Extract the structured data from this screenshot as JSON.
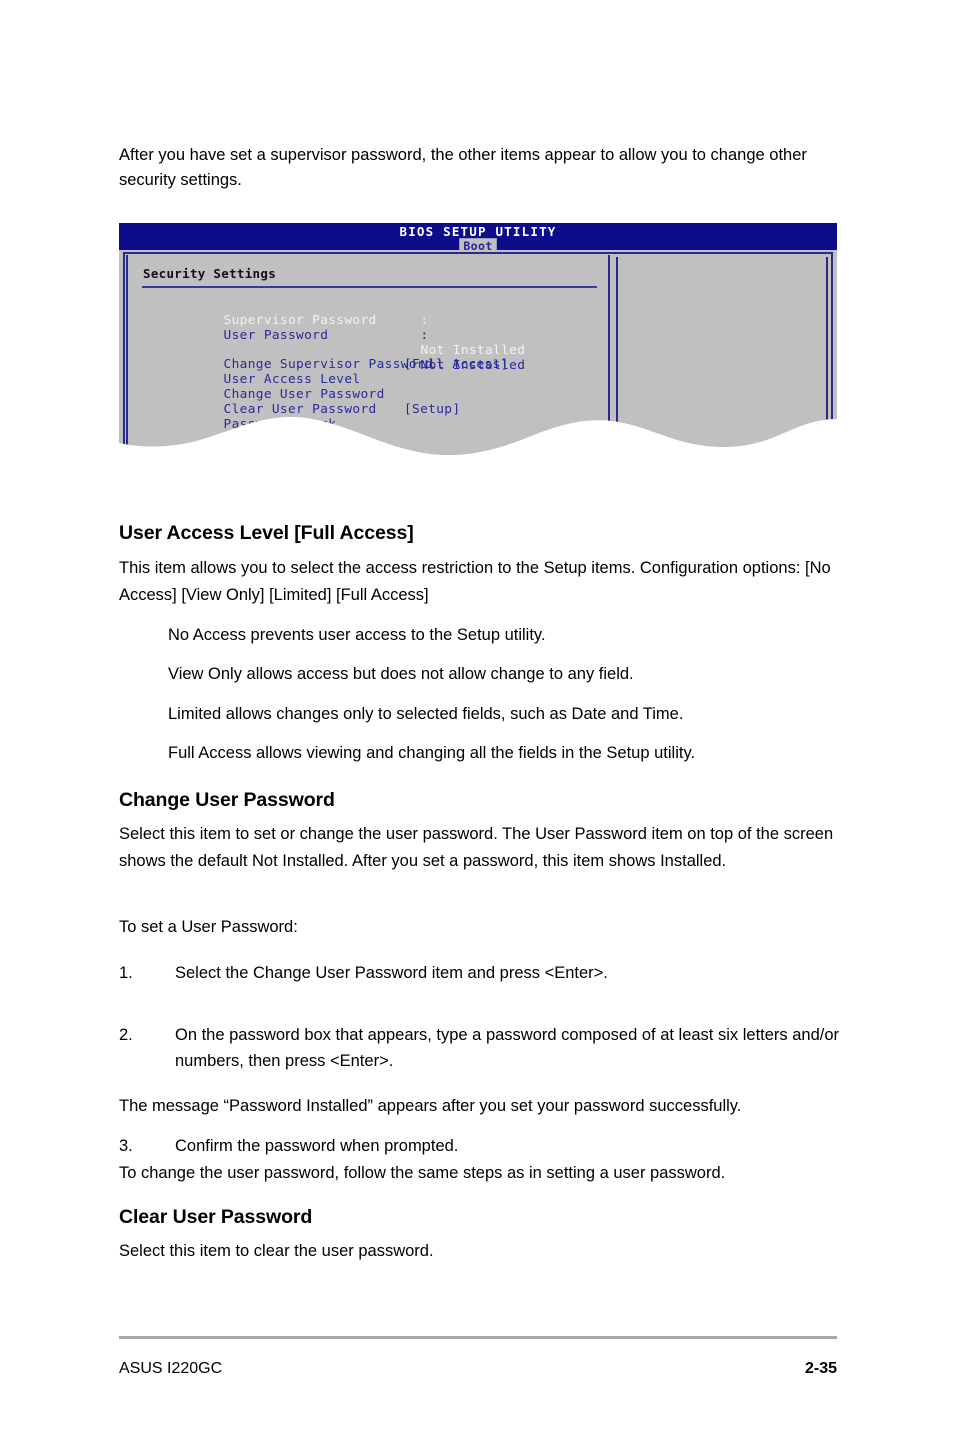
{
  "document": {
    "intro_paragraph": "After you have set a supervisor password, the other items appear to allow you to change other security settings.",
    "footer": {
      "product": "ASUS I220GC",
      "page_number": "2-35"
    }
  },
  "bios_figure": {
    "title": "BIOS SETUP UTILITY",
    "active_tab": "Boot",
    "panel_heading": "Security Settings",
    "status_rows": [
      {
        "label": "Supervisor Password",
        "separator": ":",
        "value": "Not Installed",
        "state": "disabled"
      },
      {
        "label": "User Password",
        "separator": ":",
        "value": "Not Installed",
        "state": "normal"
      }
    ],
    "menu_items": [
      {
        "label": "Change Supervisor Password",
        "value": ""
      },
      {
        "label": "User Access Level",
        "value": "[Full Access]"
      },
      {
        "label": "Change User Password",
        "value": ""
      },
      {
        "label": "Clear User Password",
        "value": ""
      },
      {
        "label": "Password Check",
        "value": "[Setup]"
      }
    ],
    "colors": {
      "header_bg": "#0d0d8c",
      "panel_bg": "#c0c0c0",
      "text_blue": "#29299c",
      "text_disabled": "#f2f2f2",
      "border_blue": "#2a2a8c"
    }
  },
  "sections": [
    {
      "heading": "User Access Level [Full Access]",
      "paragraphs": [
        "This item allows you to select the access restriction to the Setup items. Configuration options: [No Access] [View Only] [Limited] [Full Access]"
      ],
      "bullets": [
        "No Access prevents user access to the Setup utility.",
        "View Only allows access but does not allow change to any field.",
        "Limited allows changes only to selected fields, such as Date and Time.",
        "Full Access allows viewing and changing all the fields in the Setup utility."
      ]
    },
    {
      "heading": "Change User Password",
      "paragraphs": [
        "Select this item to set or change the user password. The User Password item on top of the screen shows the default Not Installed. After you set a password, this item shows Installed.",
        "To set a User Password:"
      ],
      "steps": [
        {
          "number": "1.",
          "text": "Select the Change User Password item and press <Enter>."
        },
        {
          "number": "2.",
          "text": "On the password box that appears, type a password composed of at least six letters and/or numbers, then press <Enter>."
        },
        {
          "number": "3.",
          "text": "Confirm the password when prompted."
        }
      ],
      "closing_paragraphs": [
        "The message “Password Installed” appears after you set your password successfully.",
        "To change the user password, follow the same steps as in setting a user password."
      ]
    },
    {
      "heading": "Clear User Password",
      "paragraphs": [
        "Select this item to clear the user password."
      ]
    }
  ]
}
